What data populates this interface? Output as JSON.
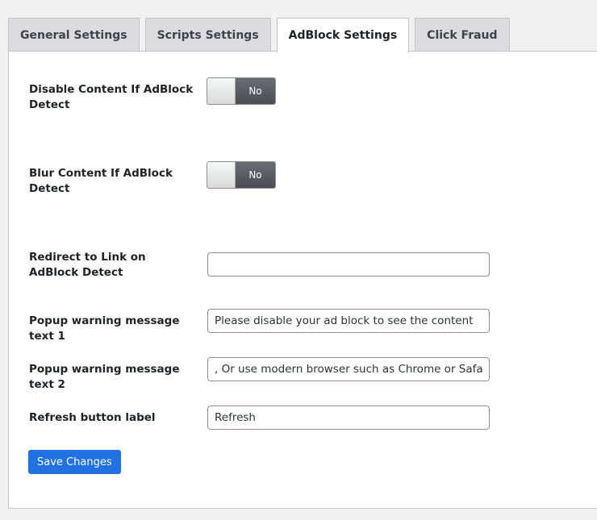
{
  "tabs": [
    {
      "label": "General Settings",
      "active": false
    },
    {
      "label": "Scripts Settings",
      "active": false
    },
    {
      "label": "AdBlock Settings",
      "active": true
    },
    {
      "label": "Click Fraud",
      "active": false
    }
  ],
  "settings": {
    "disable_content": {
      "label": "Disable Content If AdBlock Detect",
      "toggle_state": "No"
    },
    "blur_content": {
      "label": "Blur Content If AdBlock Detect",
      "toggle_state": "No"
    },
    "redirect_link": {
      "label": "Redirect to Link on AdBlock Detect",
      "value": ""
    },
    "popup_text_1": {
      "label": "Popup warning message text 1",
      "value": "Please disable your ad block to see the content"
    },
    "popup_text_2": {
      "label": "Popup warning message text 2",
      "value": ", Or use modern browser such as Chrome or Safari"
    },
    "refresh_label": {
      "label": "Refresh button label",
      "value": "Refresh"
    }
  },
  "save_button": {
    "label": "Save Changes"
  },
  "colors": {
    "accent": "#2271e3",
    "toggle_off": "#53565c",
    "tab_inactive": "#dcdcde",
    "background": "#f1f1f1"
  }
}
